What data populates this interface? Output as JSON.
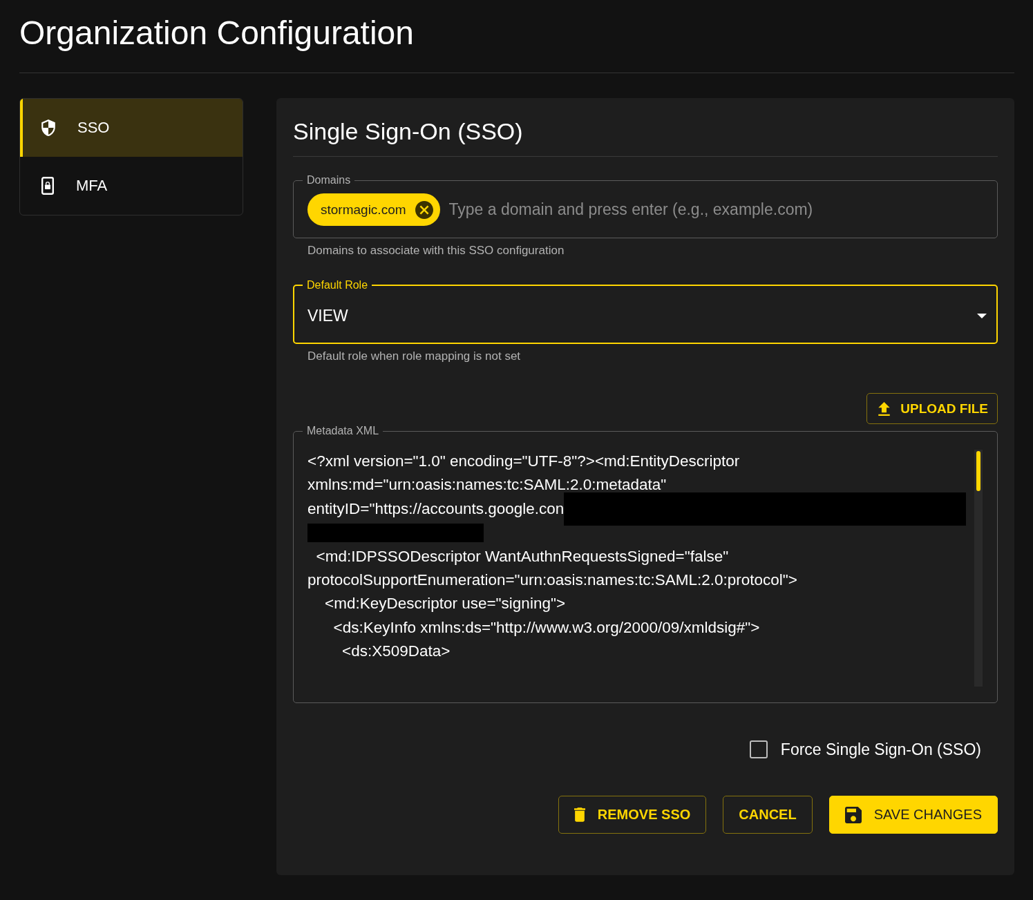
{
  "page": {
    "title": "Organization Configuration"
  },
  "sidebar": {
    "items": [
      {
        "label": "SSO",
        "selected": true
      },
      {
        "label": "MFA",
        "selected": false
      }
    ]
  },
  "panel": {
    "title": "Single Sign-On (SSO)",
    "domains": {
      "label": "Domains",
      "chips": [
        "stormagic.com"
      ],
      "placeholder": "Type a domain and press enter (e.g., example.com)",
      "helper": "Domains to associate with this SSO configuration"
    },
    "default_role": {
      "label": "Default Role",
      "value": "VIEW",
      "focused": true,
      "helper": "Default role when role mapping is not set"
    },
    "upload_button": {
      "label": "UPLOAD FILE"
    },
    "metadata_xml": {
      "label": "Metadata XML",
      "lines": [
        {
          "kind": "text",
          "text": "<?xml version=\"1.0\" encoding=\"UTF-8\"?><md:EntityDescriptor"
        },
        {
          "kind": "text",
          "text": "xmlns:md=\"urn:oasis:names:tc:SAML:2.0:metadata\""
        },
        {
          "kind": "text_redacted",
          "text": "entityID=\"https://accounts.google.con"
        },
        {
          "kind": "redacted"
        },
        {
          "kind": "text",
          "text": "  <md:IDPSSODescriptor WantAuthnRequestsSigned=\"false\""
        },
        {
          "kind": "text",
          "text": "protocolSupportEnumeration=\"urn:oasis:names:tc:SAML:2.0:protocol\">"
        },
        {
          "kind": "text",
          "text": "    <md:KeyDescriptor use=\"signing\">"
        },
        {
          "kind": "text",
          "text": "      <ds:KeyInfo xmlns:ds=\"http://www.w3.org/2000/09/xmldsig#\">"
        },
        {
          "kind": "text",
          "text": "        <ds:X509Data>"
        }
      ]
    },
    "force_sso": {
      "label": "Force Single Sign-On (SSO)",
      "checked": false
    },
    "actions": [
      {
        "label": "REMOVE SSO",
        "kind": "outlined"
      },
      {
        "label": "CANCEL",
        "kind": "outlined"
      },
      {
        "label": "SAVE CHANGES",
        "kind": "contained"
      }
    ]
  }
}
